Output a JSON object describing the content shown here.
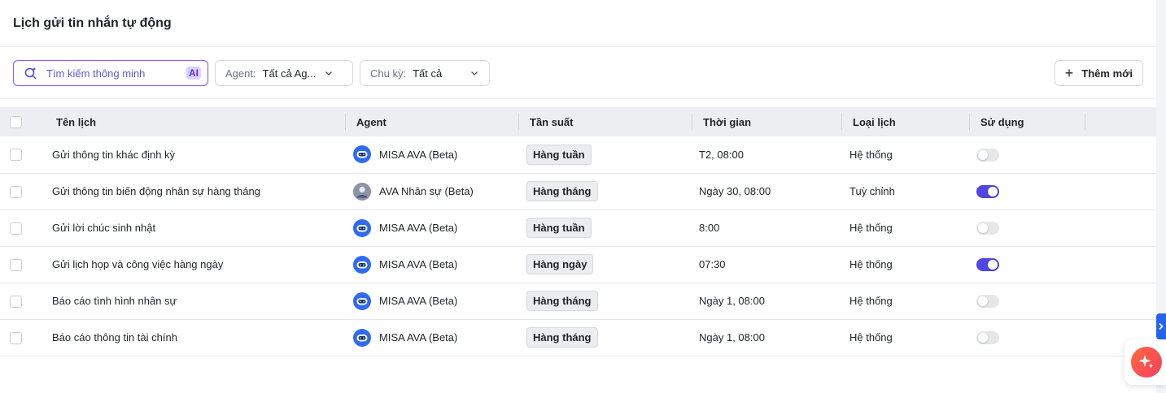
{
  "page": {
    "title": "Lịch gửi tin nhắn tự động"
  },
  "toolbar": {
    "search_placeholder": "Tìm kiếm thông minh",
    "ai_badge": "AI",
    "agent_filter": {
      "label": "Agent:",
      "value": "Tất cả Ag..."
    },
    "cycle_filter": {
      "label": "Chu kỳ:",
      "value": "Tất cả"
    },
    "add_label": "Thêm mới"
  },
  "table": {
    "columns": [
      "Tên lịch",
      "Agent",
      "Tần suất",
      "Thời gian",
      "Loại lịch",
      "Sử dụng"
    ],
    "rows": [
      {
        "name": "Gửi thông tin khác định kỳ",
        "agent": "MISA AVA (Beta)",
        "agent_avatar": "robot",
        "frequency": "Hàng tuần",
        "time": "T2, 08:00",
        "type": "Hệ thống",
        "enabled": false
      },
      {
        "name": "Gửi thông tin biến động nhân sự hàng tháng",
        "agent": "AVA Nhân sự (Beta)",
        "agent_avatar": "person",
        "frequency": "Hàng tháng",
        "time": "Ngày 30, 08:00",
        "type": "Tuỳ chỉnh",
        "enabled": true
      },
      {
        "name": "Gửi lời chúc sinh nhật",
        "agent": "MISA AVA (Beta)",
        "agent_avatar": "robot",
        "frequency": "Hàng tuần",
        "time": "8:00",
        "type": "Hệ thống",
        "enabled": false
      },
      {
        "name": "Gửi lịch họp và công việc hàng ngày",
        "agent": "MISA AVA (Beta)",
        "agent_avatar": "robot",
        "frequency": "Hàng ngày",
        "time": "07:30",
        "type": "Hệ thống",
        "enabled": true
      },
      {
        "name": "Báo cáo tình hình nhân sự",
        "agent": "MISA AVA (Beta)",
        "agent_avatar": "robot",
        "frequency": "Hàng tháng",
        "time": "Ngày 1, 08:00",
        "type": "Hệ thống",
        "enabled": false
      },
      {
        "name": "Báo cáo thông tin tài chính",
        "agent": "MISA AVA (Beta)",
        "agent_avatar": "robot",
        "frequency": "Hàng tháng",
        "time": "Ngày 1, 08:00",
        "type": "Hệ thống",
        "enabled": false
      }
    ]
  },
  "colors": {
    "accent": "#4f46e5",
    "fab": "#f4573d",
    "side_tab": "#2563eb"
  },
  "icons": {
    "search": "sparkle-search-icon",
    "add": "plus-icon",
    "fab": "sparkle-icon",
    "side_tab": "chevron-right-icon"
  }
}
